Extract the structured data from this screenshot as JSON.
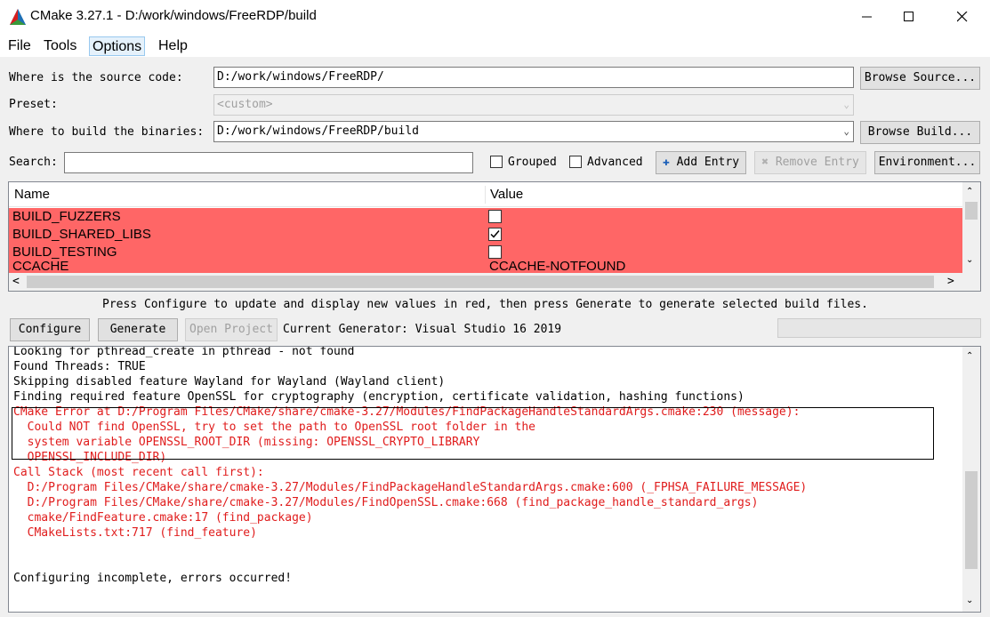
{
  "window": {
    "title": "CMake 3.27.1 - D:/work/windows/FreeRDP/build",
    "icon": "cmake-logo-icon",
    "controls": [
      "minimize-icon",
      "maximize-icon",
      "close-icon"
    ]
  },
  "menu": {
    "file": "File",
    "tools": "Tools",
    "options": "Options",
    "help": "Help"
  },
  "source": {
    "label": "Where is the source code:",
    "value": "D:/work/windows/FreeRDP/",
    "browse_label": "Browse Source..."
  },
  "preset": {
    "label": "Preset:",
    "value": "<custom>"
  },
  "build": {
    "label": "Where to build the binaries:",
    "value": "D:/work/windows/FreeRDP/build",
    "browse_label": "Browse Build..."
  },
  "search": {
    "label": "Search:",
    "value": "",
    "grouped_label": "Grouped",
    "grouped_checked": false,
    "advanced_label": "Advanced",
    "advanced_checked": false,
    "add_entry_label": "Add Entry",
    "remove_entry_label": "Remove Entry",
    "environment_label": "Environment..."
  },
  "table": {
    "columns": {
      "name": "Name",
      "value": "Value"
    },
    "highlight_color": "#ff6666",
    "rows": [
      {
        "name": "BUILD_FUZZERS",
        "type": "bool",
        "checked": false
      },
      {
        "name": "BUILD_SHARED_LIBS",
        "type": "bool",
        "checked": true
      },
      {
        "name": "BUILD_TESTING",
        "type": "bool",
        "checked": false
      },
      {
        "name": "CCACHE",
        "type": "text",
        "value": "CCACHE-NOTFOUND"
      }
    ]
  },
  "hint": "Press Configure to update and display new values in red, then press Generate to generate selected build files.",
  "actions": {
    "configure_label": "Configure",
    "generate_label": "Generate",
    "open_project_label": "Open Project",
    "current_generator": "Current Generator: Visual Studio 16 2019"
  },
  "output": {
    "error_color": "#e01c1c",
    "lines": [
      {
        "text": "Looking for pthread_create in pthread - not found",
        "error": false
      },
      {
        "text": "Found Threads: TRUE",
        "error": false
      },
      {
        "text": "Skipping disabled feature Wayland for Wayland (Wayland client)",
        "error": false
      },
      {
        "text": "Finding required feature OpenSSL for cryptography (encryption, certificate validation, hashing functions)",
        "error": false
      },
      {
        "text": "CMake Error at D:/Program Files/CMake/share/cmake-3.27/Modules/FindPackageHandleStandardArgs.cmake:230 (message):",
        "error": true
      },
      {
        "text": "  Could NOT find OpenSSL, try to set the path to OpenSSL root folder in the",
        "error": true
      },
      {
        "text": "  system variable OPENSSL_ROOT_DIR (missing: OPENSSL_CRYPTO_LIBRARY",
        "error": true
      },
      {
        "text": "  OPENSSL_INCLUDE_DIR)",
        "error": true
      },
      {
        "text": "Call Stack (most recent call first):",
        "error": true
      },
      {
        "text": "  D:/Program Files/CMake/share/cmake-3.27/Modules/FindPackageHandleStandardArgs.cmake:600 (_FPHSA_FAILURE_MESSAGE)",
        "error": true
      },
      {
        "text": "  D:/Program Files/CMake/share/cmake-3.27/Modules/FindOpenSSL.cmake:668 (find_package_handle_standard_args)",
        "error": true
      },
      {
        "text": "  cmake/FindFeature.cmake:17 (find_package)",
        "error": true
      },
      {
        "text": "  CMakeLists.txt:717 (find_feature)",
        "error": true
      },
      {
        "text": "",
        "error": false
      },
      {
        "text": "",
        "error": false
      },
      {
        "text": "Configuring incomplete, errors occurred!",
        "error": false
      }
    ]
  }
}
